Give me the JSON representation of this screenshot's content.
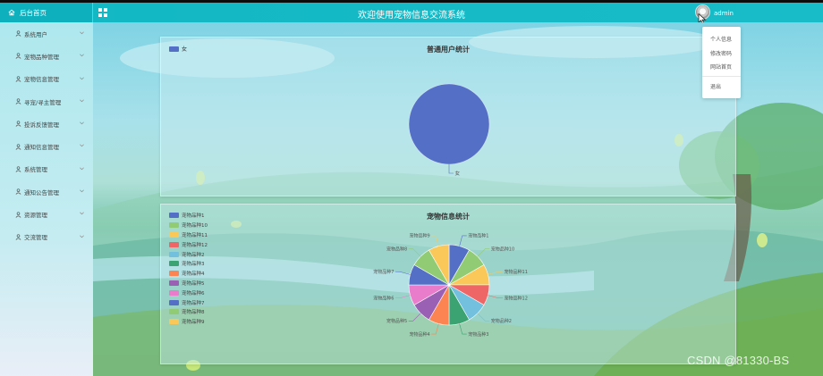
{
  "topbar": {
    "brand_label": "后台首页",
    "title": "欢迎使用宠物信息交流系统",
    "username": "admin"
  },
  "sidebar": {
    "items": [
      {
        "label": "系统用户"
      },
      {
        "label": "宠物品种管理"
      },
      {
        "label": "宠物信息管理"
      },
      {
        "label": "寻宠/寻主管理"
      },
      {
        "label": "投诉反馈管理"
      },
      {
        "label": "通知信息管理"
      },
      {
        "label": "系统管理"
      },
      {
        "label": "通知公告管理"
      },
      {
        "label": "资源管理"
      },
      {
        "label": "交流管理"
      }
    ]
  },
  "user_menu": {
    "items": [
      "个人信息",
      "修改密码",
      "网站首页"
    ],
    "logout": "退出"
  },
  "chart_data": [
    {
      "type": "pie",
      "title": "普通用户统计",
      "categories": [
        "女"
      ],
      "values": [
        1
      ],
      "colors": [
        "#5470c6"
      ],
      "legend": "top-left"
    },
    {
      "type": "pie",
      "title": "宠物信息统计",
      "categories": [
        "宠物品种1",
        "宠物品种10",
        "宠物品种11",
        "宠物品种12",
        "宠物品种2",
        "宠物品种3",
        "宠物品种4",
        "宠物品种5",
        "宠物品种6",
        "宠物品种7",
        "宠物品种8",
        "宠物品种9"
      ],
      "values": [
        1,
        1,
        1,
        1,
        1,
        1,
        1,
        1,
        1,
        1,
        1,
        1
      ],
      "colors": [
        "#5470c6",
        "#91cc75",
        "#fac858",
        "#ee6666",
        "#73c0de",
        "#3ba272",
        "#fc8452",
        "#9a60b4",
        "#ea7ccc",
        "#5470c6",
        "#91cc75",
        "#fac858"
      ],
      "legend": "left"
    }
  ],
  "watermark": "CSDN @81330-BS"
}
